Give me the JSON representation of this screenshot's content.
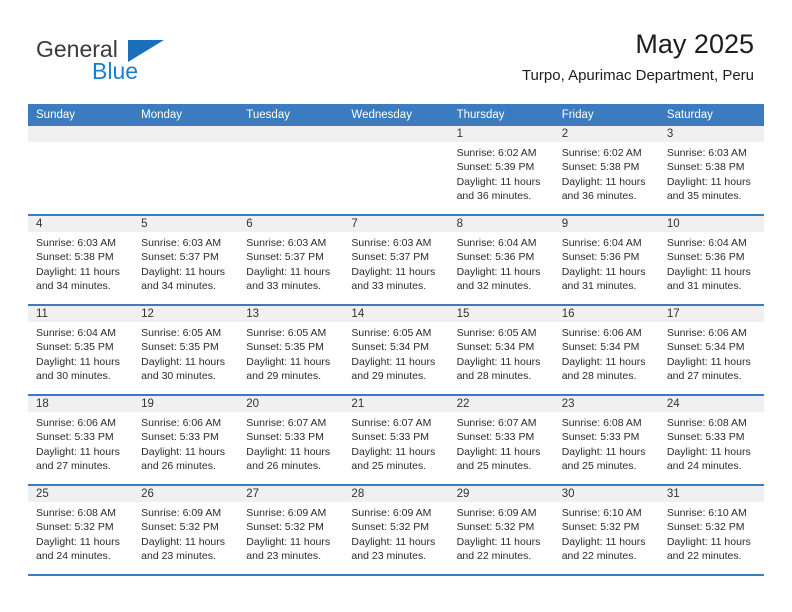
{
  "brand": {
    "name_part1": "General",
    "name_part2": "Blue",
    "triangle_color": "#1a6fb8",
    "text_color": "#3a3a3a",
    "accent_color": "#1a7fd4"
  },
  "header": {
    "title": "May 2025",
    "subtitle": "Turpo, Apurimac Department, Peru"
  },
  "theme": {
    "header_row_bg": "#3b7bbf",
    "header_row_text": "#ffffff",
    "day_band_bg": "#f0f0f0",
    "row_divider": "#3b7bbf"
  },
  "weekdays": [
    "Sunday",
    "Monday",
    "Tuesday",
    "Wednesday",
    "Thursday",
    "Friday",
    "Saturday"
  ],
  "weeks": [
    [
      {
        "day": "",
        "sunrise": "",
        "sunset": "",
        "daylight_line1": "",
        "daylight_line2": "",
        "empty": true
      },
      {
        "day": "",
        "sunrise": "",
        "sunset": "",
        "daylight_line1": "",
        "daylight_line2": "",
        "empty": true
      },
      {
        "day": "",
        "sunrise": "",
        "sunset": "",
        "daylight_line1": "",
        "daylight_line2": "",
        "empty": true
      },
      {
        "day": "",
        "sunrise": "",
        "sunset": "",
        "daylight_line1": "",
        "daylight_line2": "",
        "empty": true
      },
      {
        "day": "1",
        "sunrise": "Sunrise: 6:02 AM",
        "sunset": "Sunset: 5:39 PM",
        "daylight_line1": "Daylight: 11 hours",
        "daylight_line2": "and 36 minutes."
      },
      {
        "day": "2",
        "sunrise": "Sunrise: 6:02 AM",
        "sunset": "Sunset: 5:38 PM",
        "daylight_line1": "Daylight: 11 hours",
        "daylight_line2": "and 36 minutes."
      },
      {
        "day": "3",
        "sunrise": "Sunrise: 6:03 AM",
        "sunset": "Sunset: 5:38 PM",
        "daylight_line1": "Daylight: 11 hours",
        "daylight_line2": "and 35 minutes."
      }
    ],
    [
      {
        "day": "4",
        "sunrise": "Sunrise: 6:03 AM",
        "sunset": "Sunset: 5:38 PM",
        "daylight_line1": "Daylight: 11 hours",
        "daylight_line2": "and 34 minutes."
      },
      {
        "day": "5",
        "sunrise": "Sunrise: 6:03 AM",
        "sunset": "Sunset: 5:37 PM",
        "daylight_line1": "Daylight: 11 hours",
        "daylight_line2": "and 34 minutes."
      },
      {
        "day": "6",
        "sunrise": "Sunrise: 6:03 AM",
        "sunset": "Sunset: 5:37 PM",
        "daylight_line1": "Daylight: 11 hours",
        "daylight_line2": "and 33 minutes."
      },
      {
        "day": "7",
        "sunrise": "Sunrise: 6:03 AM",
        "sunset": "Sunset: 5:37 PM",
        "daylight_line1": "Daylight: 11 hours",
        "daylight_line2": "and 33 minutes."
      },
      {
        "day": "8",
        "sunrise": "Sunrise: 6:04 AM",
        "sunset": "Sunset: 5:36 PM",
        "daylight_line1": "Daylight: 11 hours",
        "daylight_line2": "and 32 minutes."
      },
      {
        "day": "9",
        "sunrise": "Sunrise: 6:04 AM",
        "sunset": "Sunset: 5:36 PM",
        "daylight_line1": "Daylight: 11 hours",
        "daylight_line2": "and 31 minutes."
      },
      {
        "day": "10",
        "sunrise": "Sunrise: 6:04 AM",
        "sunset": "Sunset: 5:36 PM",
        "daylight_line1": "Daylight: 11 hours",
        "daylight_line2": "and 31 minutes."
      }
    ],
    [
      {
        "day": "11",
        "sunrise": "Sunrise: 6:04 AM",
        "sunset": "Sunset: 5:35 PM",
        "daylight_line1": "Daylight: 11 hours",
        "daylight_line2": "and 30 minutes."
      },
      {
        "day": "12",
        "sunrise": "Sunrise: 6:05 AM",
        "sunset": "Sunset: 5:35 PM",
        "daylight_line1": "Daylight: 11 hours",
        "daylight_line2": "and 30 minutes."
      },
      {
        "day": "13",
        "sunrise": "Sunrise: 6:05 AM",
        "sunset": "Sunset: 5:35 PM",
        "daylight_line1": "Daylight: 11 hours",
        "daylight_line2": "and 29 minutes."
      },
      {
        "day": "14",
        "sunrise": "Sunrise: 6:05 AM",
        "sunset": "Sunset: 5:34 PM",
        "daylight_line1": "Daylight: 11 hours",
        "daylight_line2": "and 29 minutes."
      },
      {
        "day": "15",
        "sunrise": "Sunrise: 6:05 AM",
        "sunset": "Sunset: 5:34 PM",
        "daylight_line1": "Daylight: 11 hours",
        "daylight_line2": "and 28 minutes."
      },
      {
        "day": "16",
        "sunrise": "Sunrise: 6:06 AM",
        "sunset": "Sunset: 5:34 PM",
        "daylight_line1": "Daylight: 11 hours",
        "daylight_line2": "and 28 minutes."
      },
      {
        "day": "17",
        "sunrise": "Sunrise: 6:06 AM",
        "sunset": "Sunset: 5:34 PM",
        "daylight_line1": "Daylight: 11 hours",
        "daylight_line2": "and 27 minutes."
      }
    ],
    [
      {
        "day": "18",
        "sunrise": "Sunrise: 6:06 AM",
        "sunset": "Sunset: 5:33 PM",
        "daylight_line1": "Daylight: 11 hours",
        "daylight_line2": "and 27 minutes."
      },
      {
        "day": "19",
        "sunrise": "Sunrise: 6:06 AM",
        "sunset": "Sunset: 5:33 PM",
        "daylight_line1": "Daylight: 11 hours",
        "daylight_line2": "and 26 minutes."
      },
      {
        "day": "20",
        "sunrise": "Sunrise: 6:07 AM",
        "sunset": "Sunset: 5:33 PM",
        "daylight_line1": "Daylight: 11 hours",
        "daylight_line2": "and 26 minutes."
      },
      {
        "day": "21",
        "sunrise": "Sunrise: 6:07 AM",
        "sunset": "Sunset: 5:33 PM",
        "daylight_line1": "Daylight: 11 hours",
        "daylight_line2": "and 25 minutes."
      },
      {
        "day": "22",
        "sunrise": "Sunrise: 6:07 AM",
        "sunset": "Sunset: 5:33 PM",
        "daylight_line1": "Daylight: 11 hours",
        "daylight_line2": "and 25 minutes."
      },
      {
        "day": "23",
        "sunrise": "Sunrise: 6:08 AM",
        "sunset": "Sunset: 5:33 PM",
        "daylight_line1": "Daylight: 11 hours",
        "daylight_line2": "and 25 minutes."
      },
      {
        "day": "24",
        "sunrise": "Sunrise: 6:08 AM",
        "sunset": "Sunset: 5:33 PM",
        "daylight_line1": "Daylight: 11 hours",
        "daylight_line2": "and 24 minutes."
      }
    ],
    [
      {
        "day": "25",
        "sunrise": "Sunrise: 6:08 AM",
        "sunset": "Sunset: 5:32 PM",
        "daylight_line1": "Daylight: 11 hours",
        "daylight_line2": "and 24 minutes."
      },
      {
        "day": "26",
        "sunrise": "Sunrise: 6:09 AM",
        "sunset": "Sunset: 5:32 PM",
        "daylight_line1": "Daylight: 11 hours",
        "daylight_line2": "and 23 minutes."
      },
      {
        "day": "27",
        "sunrise": "Sunrise: 6:09 AM",
        "sunset": "Sunset: 5:32 PM",
        "daylight_line1": "Daylight: 11 hours",
        "daylight_line2": "and 23 minutes."
      },
      {
        "day": "28",
        "sunrise": "Sunrise: 6:09 AM",
        "sunset": "Sunset: 5:32 PM",
        "daylight_line1": "Daylight: 11 hours",
        "daylight_line2": "and 23 minutes."
      },
      {
        "day": "29",
        "sunrise": "Sunrise: 6:09 AM",
        "sunset": "Sunset: 5:32 PM",
        "daylight_line1": "Daylight: 11 hours",
        "daylight_line2": "and 22 minutes."
      },
      {
        "day": "30",
        "sunrise": "Sunrise: 6:10 AM",
        "sunset": "Sunset: 5:32 PM",
        "daylight_line1": "Daylight: 11 hours",
        "daylight_line2": "and 22 minutes."
      },
      {
        "day": "31",
        "sunrise": "Sunrise: 6:10 AM",
        "sunset": "Sunset: 5:32 PM",
        "daylight_line1": "Daylight: 11 hours",
        "daylight_line2": "and 22 minutes."
      }
    ]
  ]
}
